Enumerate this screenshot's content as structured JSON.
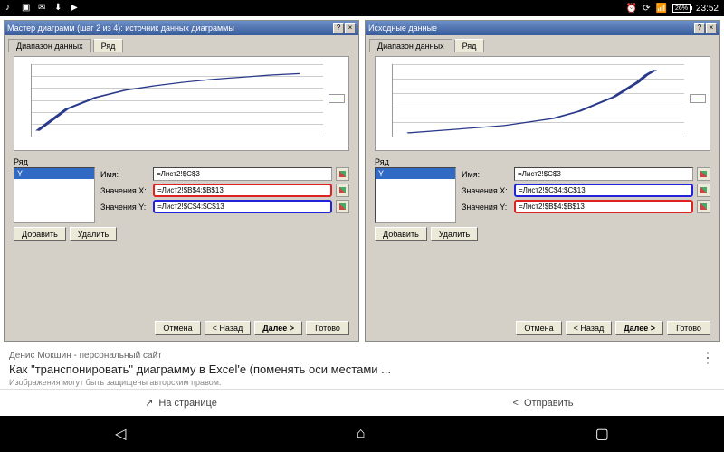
{
  "statusbar": {
    "battery": "26%",
    "time": "23:52"
  },
  "dlg_left": {
    "title": "Мастер диаграмм (шаг 2 из 4): источник данных диаграммы",
    "tab1": "Диапазон данных",
    "tab2": "Ряд",
    "section": "Ряд",
    "list_item": "Y",
    "name_lbl": "Имя:",
    "name_val": "=Лист2!$C$3",
    "x_lbl": "Значения X:",
    "x_val": "=Лист2!$B$4:$B$13",
    "y_lbl": "Значения Y:",
    "y_val": "=Лист2!$C$4:$C$13",
    "add": "Добавить",
    "del": "Удалить",
    "cancel": "Отмена",
    "back": "< Назад",
    "next": "Далее >",
    "finish": "Готово"
  },
  "dlg_right": {
    "title": "Исходные данные",
    "tab1": "Диапазон данных",
    "tab2": "Ряд",
    "section": "Ряд",
    "list_item": "Y",
    "name_lbl": "Имя:",
    "name_val": "=Лист2!$C$3",
    "x_lbl": "Значения X:",
    "x_val": "=Лист2!$C$4:$C$13",
    "y_lbl": "Значения Y:",
    "y_val": "=Лист2!$B$4:$B$13",
    "add": "Добавить",
    "del": "Удалить",
    "cancel": "Отмена",
    "back": "< Назад",
    "next": "Далее >",
    "finish": "Готово"
  },
  "chart_data": [
    {
      "type": "line",
      "title": "",
      "xlabel": "",
      "ylabel": "",
      "xlim": [
        0,
        50
      ],
      "ylim": [
        0,
        14
      ],
      "series": [
        {
          "name": "Y",
          "x": [
            0,
            5,
            10,
            15,
            20,
            25,
            30,
            35,
            40,
            45
          ],
          "y": [
            1,
            5,
            7.5,
            9,
            10,
            10.8,
            11.5,
            12,
            12.4,
            12.8
          ]
        }
      ]
    },
    {
      "type": "line",
      "title": "",
      "xlabel": "",
      "ylabel": "",
      "xlim": [
        0,
        14
      ],
      "ylim": [
        0,
        50
      ],
      "series": [
        {
          "name": "Y",
          "x": [
            1,
            5,
            7.5,
            9,
            10,
            10.8,
            11.5,
            12,
            12.4,
            12.8
          ],
          "y": [
            0,
            5,
            10,
            15,
            20,
            25,
            30,
            35,
            40,
            45
          ]
        }
      ]
    }
  ],
  "caption": {
    "source": "Денис Мокшин - персональный сайт",
    "title": "Как \"транспонировать\" диаграмму в Excel'е (поменять оси местами ...",
    "note": "Изображения могут быть защищены авторским правом."
  },
  "actions": {
    "page": "На странице",
    "share": "Отправить"
  }
}
